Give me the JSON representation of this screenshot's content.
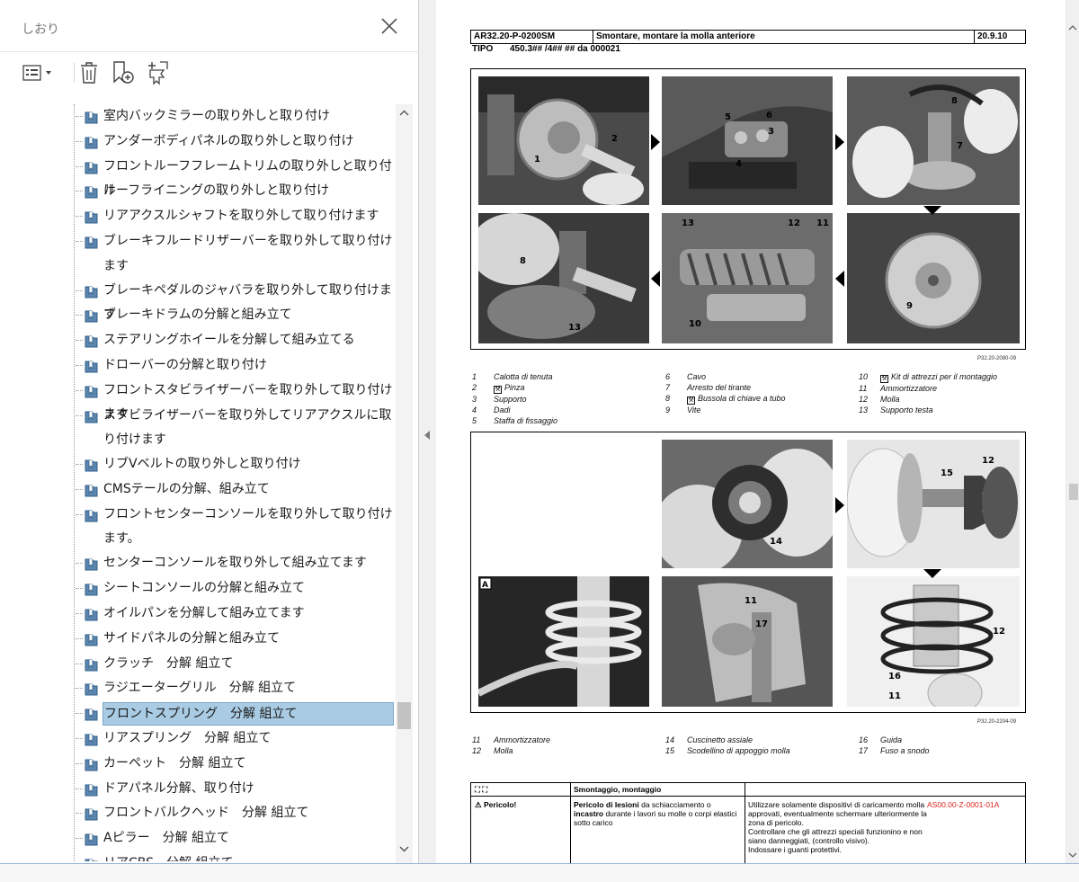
{
  "panel": {
    "title": "しおり",
    "close_icon": "close-icon",
    "toolbar": {
      "options_icon": "options-list-icon",
      "delete_icon": "trash-icon",
      "new_bookmark_icon": "new-bookmark-icon",
      "expand_icon": "bookmark-expand-icon"
    },
    "bookmarks": [
      {
        "label": "室内バックミラーの取り外しと取り付け"
      },
      {
        "label": "アンダーボディパネルの取り外しと取り付け"
      },
      {
        "label": "フロントルーフフレームトリムの取り外しと取り付け"
      },
      {
        "label": "ルーフライニングの取り外しと取り付け"
      },
      {
        "label": "リアアクスルシャフトを取り外して取り付けます"
      },
      {
        "label": "ブレーキフルードリザーバーを取り外して取り付けます"
      },
      {
        "label": "ブレーキペダルのジャバラを取り外して取り付けます"
      },
      {
        "label": "ブレーキドラムの分解と組み立て"
      },
      {
        "label": "ステアリングホイールを分解して組み立てる"
      },
      {
        "label": "ドローバーの分解と取り付け"
      },
      {
        "label": "フロントスタビライザーバーを取り外して取り付けます"
      },
      {
        "label": "スタビライザーバーを取り外してリアアクスルに取り付けます"
      },
      {
        "label": "リブVベルトの取り外しと取り付け"
      },
      {
        "label": "CMSテールの分解、組み立て"
      },
      {
        "label": "フロントセンターコンソールを取り外して取り付けます。"
      },
      {
        "label": "センターコンソールを取り外して組み立てます"
      },
      {
        "label": "シートコンソールの分解と組み立て"
      },
      {
        "label": "オイルパンを分解して組み立てます"
      },
      {
        "label": "サイドパネルの分解と組み立て"
      },
      {
        "label": "クラッチ　分解 組立て"
      },
      {
        "label": "ラジエーターグリル　分解 組立て"
      },
      {
        "label": "フロントスプリング　分解 組立て",
        "selected": true
      },
      {
        "label": "リアスプリング　分解 組立て"
      },
      {
        "label": "カーペット　分解 組立て"
      },
      {
        "label": "ドアパネル分解、取り付け"
      },
      {
        "label": "フロントバルクヘッド　分解 組立て"
      },
      {
        "label": "Aピラー　分解 組立て"
      },
      {
        "label": "リアCBS　分解 組立て"
      }
    ]
  },
  "doc": {
    "header": {
      "code": "AR32.20-P-0200SM",
      "title": "Smontare, montare la molla anteriore",
      "date": "20.9.10"
    },
    "tipo_label": "TIPO",
    "tipo_value": "450.3## /4## ## da 000021",
    "fig1": {
      "ref": "P32.20-2080-09",
      "callouts": {
        "p1": [
          "1",
          "2"
        ],
        "p2": [
          "5",
          "6",
          "3",
          "4"
        ],
        "p3": [
          "8",
          "7"
        ],
        "p4": [
          "8",
          "13"
        ],
        "p5": [
          "13",
          "12",
          "11",
          "10"
        ],
        "p6": [
          "9"
        ]
      },
      "legend": [
        {
          "n": "1",
          "t": "Calotta di tenuta"
        },
        {
          "n": "2",
          "t": "Pinza",
          "tool": true
        },
        {
          "n": "3",
          "t": "Supporto"
        },
        {
          "n": "4",
          "t": "Dadi"
        },
        {
          "n": "5",
          "t": "Staffa di fissaggio"
        },
        {
          "n": "6",
          "t": "Cavo"
        },
        {
          "n": "7",
          "t": "Arresto del tirante"
        },
        {
          "n": "8",
          "t": "Bussola di chiave a tubo",
          "tool": true
        },
        {
          "n": "9",
          "t": "Vite"
        },
        {
          "n": "10",
          "t": "Kit di attrezzi per il montaggio",
          "tool": true
        },
        {
          "n": "11",
          "t": "Ammortizzatore"
        },
        {
          "n": "12",
          "t": "Molla"
        },
        {
          "n": "13",
          "t": "Supporto testa"
        }
      ]
    },
    "fig2": {
      "ref": "P32.20-2204-09",
      "callouts": {
        "p2": [
          "14"
        ],
        "p3": [
          "15",
          "12"
        ],
        "p4": [
          "A"
        ],
        "p5": [
          "11",
          "17"
        ],
        "p6": [
          "12",
          "16",
          "11"
        ]
      },
      "legend": [
        {
          "n": "11",
          "t": "Ammortizzatore"
        },
        {
          "n": "12",
          "t": "Molla"
        },
        {
          "n": "14",
          "t": "Cuscinetto assiale"
        },
        {
          "n": "15",
          "t": "Scodellino di appoggio molla"
        },
        {
          "n": "16",
          "t": "Guida"
        },
        {
          "n": "17",
          "t": "Fuso a snodo"
        }
      ]
    },
    "table": {
      "head_icons": "⛶ ⛶",
      "head_title": "Smontaggio, montaggio",
      "danger_label": "Pericolo!",
      "danger_text_bold": "Pericolo di lesioni",
      "danger_text_1": " da schiacciamento o ",
      "danger_text_bold2": "incastro",
      "danger_text_2": " durante i lavori su molle o corpi elastici sotto carico",
      "instr_1": "Utilizzare solamente dispositivi di caricamento molla approvati, eventualmente schermare ulteriormente la zona di pericolo.",
      "instr_2": "Controllare che gli attrezzi speciali funzionino e non siano danneggiati, (controllo visivo).",
      "instr_3": "Indossare i guanti protettivi.",
      "ref": "AS00.00-Z-0001-01A"
    }
  }
}
